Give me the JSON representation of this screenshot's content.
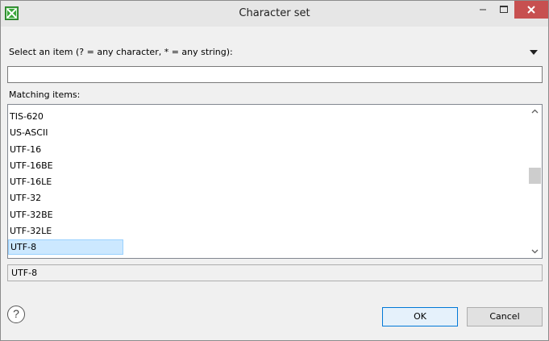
{
  "window": {
    "title": "Character set"
  },
  "filter": {
    "prompt": "Select an item (? = any character, * = any string):",
    "value": "",
    "placeholder": ""
  },
  "list": {
    "label": "Matching items:",
    "items": [
      "TIS-620",
      "US-ASCII",
      "UTF-16",
      "UTF-16BE",
      "UTF-16LE",
      "UTF-32",
      "UTF-32BE",
      "UTF-32LE",
      "UTF-8"
    ],
    "selected_index": 8
  },
  "status": {
    "text": "UTF-8"
  },
  "buttons": {
    "help_glyph": "?",
    "ok_label": "OK",
    "cancel_label": "Cancel"
  },
  "colors": {
    "selection_bg": "#cce8ff",
    "close_button": "#c75050",
    "ok_border": "#0078d7"
  }
}
